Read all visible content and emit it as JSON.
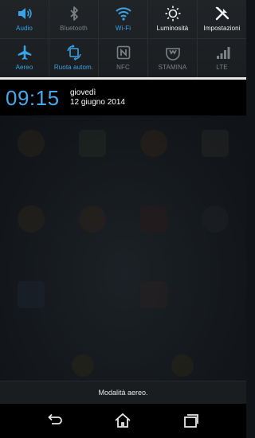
{
  "quick_settings": {
    "row1": [
      {
        "label": "Audio",
        "icon": "speaker-icon",
        "state": "on"
      },
      {
        "label": "Bluetooth",
        "icon": "bluetooth-icon",
        "state": "off"
      },
      {
        "label": "Wi-Fi",
        "icon": "wifi-icon",
        "state": "on"
      },
      {
        "label": "Luminosità",
        "icon": "brightness-icon",
        "state": "white"
      },
      {
        "label": "Impostazioni",
        "icon": "settings-tools-icon",
        "state": "white"
      }
    ],
    "row2": [
      {
        "label": "Aereo",
        "icon": "airplane-icon",
        "state": "on"
      },
      {
        "label": "Ruota autom.",
        "icon": "rotate-icon",
        "state": "on"
      },
      {
        "label": "NFC",
        "icon": "nfc-icon",
        "state": "off"
      },
      {
        "label": "STAMINA",
        "icon": "stamina-icon",
        "state": "off"
      },
      {
        "label": "LTE",
        "icon": "signal-bars-icon",
        "state": "off"
      }
    ]
  },
  "clock": {
    "time": "09:15",
    "day": "giovedì",
    "date": "12 giugno 2014"
  },
  "notification": {
    "text": "Modalità aereo."
  },
  "colors": {
    "accent": "#3aa3e6",
    "off": "#7b8185",
    "background": "#111519"
  }
}
